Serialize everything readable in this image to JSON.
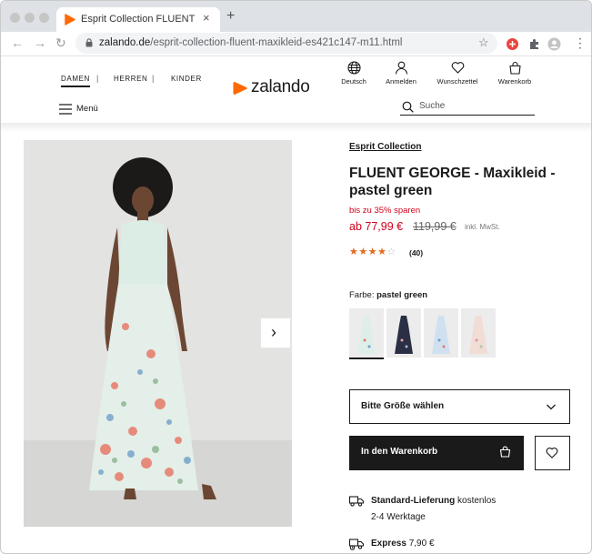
{
  "browser": {
    "tab_title": "Esprit Collection FLUENT GEORGE",
    "tab_close": "×",
    "new_tab": "+",
    "url_host": "zalando.de",
    "url_path": "/esprit-collection-fluent-maxikleid-es421c147-m11.html",
    "nav_back": "←",
    "nav_forward": "→",
    "nav_reload": "↻",
    "bookmark_star": "☆",
    "menu_dots": "⋮"
  },
  "header": {
    "genders": [
      "DAMEN",
      "HERREN",
      "KINDER"
    ],
    "separator": "|",
    "logo_text": "zalando",
    "actions": [
      {
        "label": "Deutsch",
        "icon": "globe-icon"
      },
      {
        "label": "Anmelden",
        "icon": "user-icon"
      },
      {
        "label": "Wunschzettel",
        "icon": "heart-icon"
      },
      {
        "label": "Warenkorb",
        "icon": "bag-icon"
      }
    ],
    "menu_label": "Menü",
    "search_placeholder": "Suche"
  },
  "product": {
    "brand": "Esprit Collection",
    "title": "FLUENT GEORGE - Maxikleid - pastel green",
    "savings": "bis zu 35% sparen",
    "price": "ab 77,99 €",
    "old_price": "119,99 €",
    "vat_note": "inkl. MwSt.",
    "rating": 4,
    "rating_max": 5,
    "stars_filled": "★★★★",
    "stars_empty": "☆",
    "review_count": "(40)",
    "color_label": "Farbe:",
    "color_value": "pastel green",
    "swatches": [
      {
        "name": "pastel green",
        "fill": "#dfeee9",
        "selected": true
      },
      {
        "name": "navy",
        "fill": "#2a2f45",
        "selected": false
      },
      {
        "name": "light blue",
        "fill": "#cfe0f1",
        "selected": false
      },
      {
        "name": "nude",
        "fill": "#f1dcd6",
        "selected": false
      }
    ],
    "size_placeholder": "Bitte Größe wählen",
    "add_to_cart": "In den Warenkorb",
    "next_image": "›"
  },
  "shipping": {
    "standard_label": "Standard-Lieferung",
    "standard_value": "kostenlos",
    "standard_time": "2-4 Werktage",
    "express_label": "Express",
    "express_value": "7,90 €"
  },
  "colors": {
    "accent_orange": "#ff6900",
    "sale_red": "#d0021b",
    "star_orange": "#e46a1d",
    "button_black": "#1a1a1a"
  }
}
